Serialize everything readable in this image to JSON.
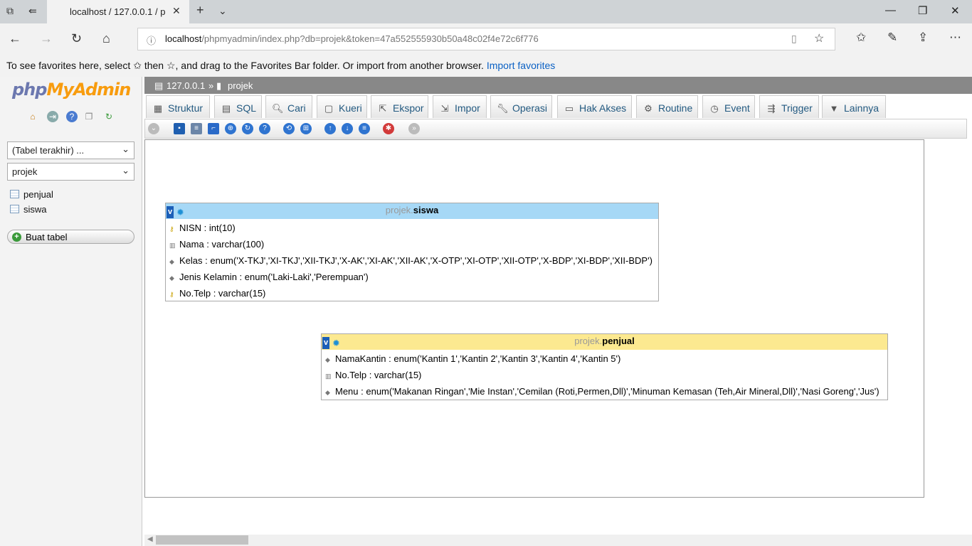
{
  "browser": {
    "tab_title": "localhost / 127.0.0.1 / p",
    "url_host": "localhost",
    "url_path": "/phpmyadmin/index.php?db=projek&token=47a552555930b50a48c02f4e72c6f776",
    "favorites_msg_1": "To see favorites here, select",
    "favorites_msg_2": "then ☆, and drag to the Favorites Bar folder. Or import from another browser.",
    "favorites_link": "Import favorites"
  },
  "logo": {
    "php": "php",
    "myadmin": "MyAdmin"
  },
  "nav": {
    "recent_tables": "(Tabel terakhir) ...",
    "database": "projek",
    "tables": [
      "penjual",
      "siswa"
    ],
    "create_table": "Buat tabel"
  },
  "breadcrumb": {
    "server": "127.0.0.1",
    "sep": "»",
    "db": "projek"
  },
  "tabs": [
    "Struktur",
    "SQL",
    "Cari",
    "Kueri",
    "Ekspor",
    "Impor",
    "Operasi",
    "Hak Akses",
    "Routine",
    "Event",
    "Trigger",
    "Lainnya"
  ],
  "designer": {
    "siswa": {
      "db": "projek.",
      "name": "siswa",
      "header_color": "#a6d8f6",
      "rows": [
        "NISN : int(10)",
        "Nama : varchar(100)",
        "Kelas : enum('X-TKJ','XI-TKJ','XII-TKJ','X-AK','XI-AK','XII-AK','X-OTP','XI-OTP','XII-OTP','X-BDP','XI-BDP','XII-BDP')",
        "Jenis Kelamin : enum('Laki-Laki','Perempuan')",
        "No.Telp : varchar(15)"
      ]
    },
    "penjual": {
      "db": "projek.",
      "name": "penjual",
      "header_color": "#fce990",
      "rows": [
        "NamaKantin : enum('Kantin 1','Kantin 2','Kantin 3','Kantin 4','Kantin 5')",
        "No.Telp : varchar(15)",
        "Menu : enum('Makanan Ringan','Mie Instan','Cemilan (Roti,Permen,Dll)','Minuman Kemasan (Teh,Air Mineral,Dll)','Nasi Goreng','Jus')"
      ]
    }
  }
}
